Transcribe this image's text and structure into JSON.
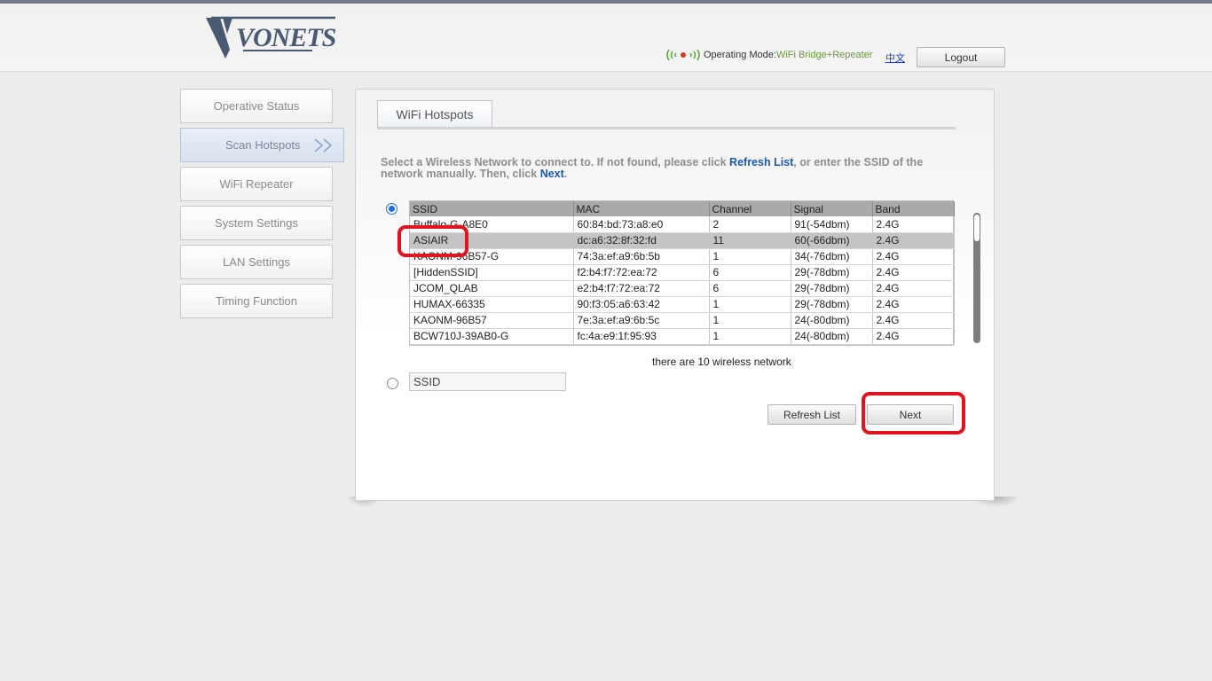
{
  "header": {
    "logo_text": "VONETS",
    "mode_label": "Operating Mode:",
    "mode_value": "WiFi Bridge+Repeater",
    "language_link": "中文",
    "logout_label": "Logout"
  },
  "sidebar": {
    "items": [
      {
        "label": "Operative Status"
      },
      {
        "label": "Scan Hotspots",
        "active": true
      },
      {
        "label": "WiFi Repeater"
      },
      {
        "label": "System Settings"
      },
      {
        "label": "LAN Settings"
      },
      {
        "label": "Timing Function"
      }
    ]
  },
  "main": {
    "tab_label": "WiFi Hotspots",
    "instruction": {
      "part1": "Select a Wireless Network to connect to. If not found, please click ",
      "link1": "Refresh List",
      "part2": ", or enter the SSID of the network manually. Then, click ",
      "link2": "Next",
      "part3": "."
    },
    "table": {
      "columns": [
        "SSID",
        "MAC",
        "Channel",
        "Signal",
        "Band"
      ],
      "rows": [
        [
          "Buffalo-G-A8E0",
          "60:84:bd:73:a8:e0",
          "2",
          "91(-54dbm)",
          "2.4G"
        ],
        [
          "ASIAIR",
          "dc:a6:32:8f:32:fd",
          "11",
          "60(-66dbm)",
          "2.4G"
        ],
        [
          "KAONM-96B57-G",
          "74:3a:ef:a9:6b:5b",
          "1",
          "34(-76dbm)",
          "2.4G"
        ],
        [
          "[HiddenSSID]",
          "f2:b4:f7:72:ea:72",
          "6",
          "29(-78dbm)",
          "2.4G"
        ],
        [
          "JCOM_QLAB",
          "e2:b4:f7:72:ea:72",
          "6",
          "29(-78dbm)",
          "2.4G"
        ],
        [
          "HUMAX-66335",
          "90:f3:05:a6:63:42",
          "1",
          "29(-78dbm)",
          "2.4G"
        ],
        [
          "KAONM-96B57",
          "7e:3a:ef:a9:6b:5c",
          "1",
          "24(-80dbm)",
          "2.4G"
        ],
        [
          "BCW710J-39AB0-G",
          "fc:4a:e9:1f:95:93",
          "1",
          "24(-80dbm)",
          "2.4G"
        ]
      ],
      "selected_row": 1
    },
    "network_count": "there are 10 wireless network",
    "ssid_input_value": "SSID",
    "refresh_button": "Refresh List",
    "next_button": "Next"
  },
  "colors": {
    "accent_link": "#1a5aa8",
    "mode_value": "#6a9a3a",
    "annotation": "#e0141e"
  }
}
